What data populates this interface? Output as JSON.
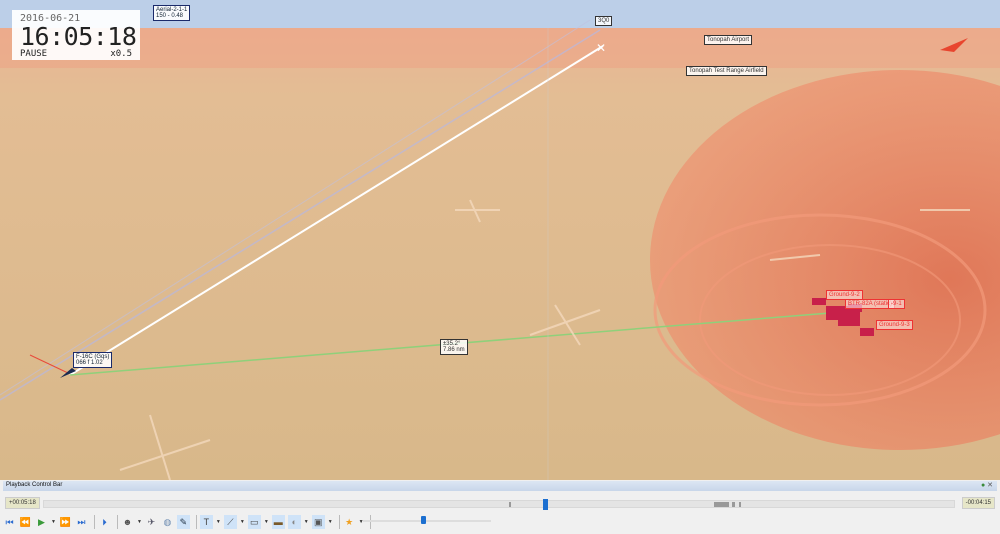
{
  "clock": {
    "date": "2016-06-21",
    "time": "16:05:18",
    "state": "PAUSE",
    "speed": "x0.5"
  },
  "labels": {
    "aerial": {
      "name": "Aerial-2-1-1",
      "info": "150 - 0.48"
    },
    "waypoint": "3Q0",
    "airport1": "Tonopah Airport",
    "airport2": "Tonopah Test Range Airfield",
    "player": {
      "name": "F-16C (Gqs)",
      "info": "066 f 1.02"
    },
    "measure": {
      "angle": "±35.2°",
      "dist": "7.86 nm"
    },
    "ground": [
      "Ground-9-2",
      "BTR-82A (static)",
      "-9-1",
      "Ground-9-3"
    ]
  },
  "playback": {
    "title": "Playback Control Bar",
    "elapsed": "+00:05:18",
    "remaining": "-00:04:15",
    "progress": 0.55,
    "speed_slider": 0.45
  },
  "colors": {
    "terrain": "#dbb98a",
    "threat": "#f07a5a",
    "sky": "#b8cde8",
    "accent": "#1c6fd0"
  }
}
